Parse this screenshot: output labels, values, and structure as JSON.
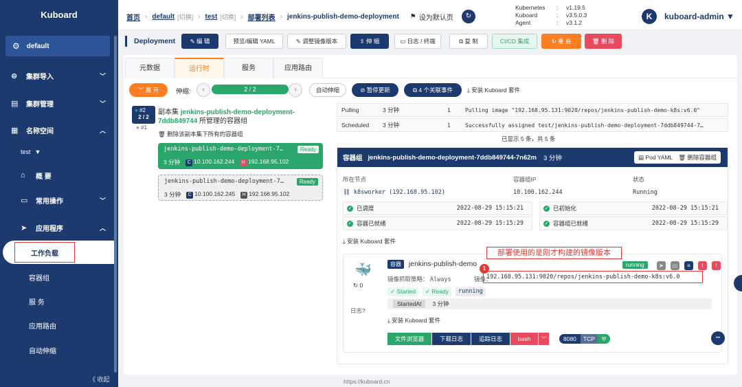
{
  "sidebar": {
    "logo": "Kuboard",
    "namespace": "default",
    "items": [
      {
        "label": "集群导入",
        "icon": "cluster-import-icon"
      },
      {
        "label": "集群管理",
        "icon": "cluster-manage-icon"
      },
      {
        "label": "名称空间",
        "icon": "namespace-icon"
      }
    ],
    "ns_select": "test",
    "sub_items": [
      {
        "label": "概 要"
      },
      {
        "label": "常用操作"
      },
      {
        "label": "应用程序"
      }
    ],
    "app_items": [
      "工作负载",
      "容器组",
      "服 务",
      "应用路由",
      "自动伸缩"
    ],
    "collapse": "《 收起"
  },
  "header": {
    "crumbs": [
      "首页",
      "default",
      "[切换]",
      "test",
      "[切换]",
      "部署列表",
      "jenkins-publish-demo-deployment"
    ],
    "set_default": "设为默认页",
    "versions": [
      {
        "k": "Kubernetes",
        "v": "v1.19.5"
      },
      {
        "k": "Kuboard",
        "v": "v3.5.0.3"
      },
      {
        "k": "Agent",
        "v": "v3.1.2"
      }
    ],
    "avatar": "K",
    "user": "kuboard-admin ▼"
  },
  "actions": {
    "title": "Deployment",
    "edit": "编 辑",
    "yaml": "预览/编辑 YAML",
    "image": "调整镜像版本",
    "scale": "伸 缩",
    "logs": "日志 / 终端",
    "copy": "复 制",
    "cicd": "CI/CD 集成",
    "restart": "重 启",
    "delete": "删 除"
  },
  "tabs": [
    "元数据",
    "运行时",
    "服务",
    "应用路由"
  ],
  "controls": {
    "expand": "展 开",
    "scale_label": "伸缩:",
    "scale_value": "2 / 2",
    "autoscale": "自动伸缩",
    "pause": "暂停更新",
    "events": "4 个关联事件",
    "install": "安装 Kuboard 套件"
  },
  "replicaset": {
    "badge_rev": "#2",
    "badge_count": "2 / 2",
    "old_rev": "#1",
    "title_prefix": "副本集",
    "name": "jenkins-publish-demo-deployment-7ddb849744",
    "title_suffix": "所管理的容器组",
    "delete_all": "删除该副本集下所有的容器组"
  },
  "pods": [
    {
      "name": "jenkins-publish-demo-deployment-7…",
      "status": "Ready",
      "age": "3 分钟",
      "pod_ip": "10.100.162.244",
      "host_ip": "192.168.95.102"
    },
    {
      "name": "jenkins-publish-demo-deployment-7…",
      "status": "Ready",
      "age": "3 分钟",
      "pod_ip": "10.100.162.245",
      "host_ip": "192.168.95.102"
    }
  ],
  "events": [
    {
      "reason": "Pulling",
      "age": "3 分钟",
      "count": "1",
      "message": "Pulling image \"192.168.95.131:9020/repos/jenkins-publish-demo-k8s:v6.0\""
    },
    {
      "reason": "Scheduled",
      "age": "3 分钟",
      "count": "1",
      "message": "Successfully assigned test/jenkins-publish-demo-deployment-7ddb849744-7…"
    }
  ],
  "events_summary": "已显示 5 条，共 5 条",
  "pod_detail": {
    "label": "容器组",
    "name": "jenkins-publish-demo-deployment-7ddb849744-7n62m",
    "age": "3 分钟",
    "pod_yaml": "Pod YAML",
    "delete_pod": "删除容器组",
    "node_label": "所在节点",
    "node_value": "k8sworker (192.168.95.102)",
    "ip_label": "容器组IP",
    "ip_value": "10.100.162.244",
    "status_label": "状态",
    "status_value": "Running",
    "conditions": [
      {
        "label": "已调度",
        "time": "2022-08-29 15:15:21"
      },
      {
        "label": "已初始化",
        "time": "2022-08-29 15:15:21"
      },
      {
        "label": "容器已就绪",
        "time": "2022-08-29 15:15:29"
      },
      {
        "label": "容器组已就绪",
        "time": "2022-08-29 15:15:29"
      }
    ],
    "install": "安装 Kuboard 套件"
  },
  "container": {
    "tag": "容器",
    "name": "jenkins-publish-demo",
    "state": "running",
    "restarts": "0",
    "pull_policy_label": "镜像抓取策略：",
    "pull_policy": "Always",
    "image_label": "镜像：",
    "image": "192.168.95.131:9020/repos/jenkins-publish-demo-k8s:v6.0",
    "started": "Started",
    "ready": "Ready",
    "running": "running",
    "started_at_label": "StartedAt",
    "started_at": "3 分钟",
    "log_label": "日志",
    "install": "安装 Kuboard 套件",
    "buttons": [
      "文件浏览器",
      "下载日志",
      "追踪日志",
      "bash"
    ],
    "port": "8080",
    "protocol": "TCP",
    "more": "•••"
  },
  "annotation": {
    "text": "部署使用的是刚才构建的镜像版本",
    "number": "1"
  },
  "footer": "https://kuboard.cn",
  "colors": {
    "navy": "#1d3a6e",
    "green": "#2aa66b",
    "orange": "#fb7e22",
    "red": "#e84a5f"
  }
}
